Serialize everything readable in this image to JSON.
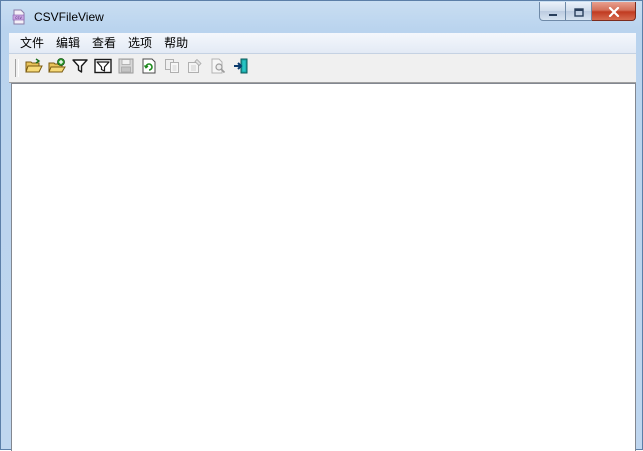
{
  "window": {
    "title": "CSVFileView",
    "app_icon": "csv-app-icon",
    "controls": [
      "minimize-icon",
      "maximize-icon",
      "close-icon"
    ]
  },
  "menu": {
    "items": [
      {
        "label": "文件"
      },
      {
        "label": "编辑"
      },
      {
        "label": "查看"
      },
      {
        "label": "选项"
      },
      {
        "label": "帮助"
      }
    ]
  },
  "toolbar": {
    "buttons": [
      {
        "icon": "open-folder-icon",
        "enabled": true
      },
      {
        "icon": "open-folder-add-icon",
        "enabled": true
      },
      {
        "icon": "filter-icon",
        "enabled": true
      },
      {
        "icon": "advanced-filter-icon",
        "enabled": true
      },
      {
        "icon": "save-icon",
        "enabled": false
      },
      {
        "icon": "refresh-icon",
        "enabled": true
      },
      {
        "icon": "copy-icon",
        "enabled": false
      },
      {
        "icon": "properties-icon",
        "enabled": false
      },
      {
        "icon": "find-icon",
        "enabled": false
      },
      {
        "icon": "exit-icon",
        "enabled": true
      }
    ]
  },
  "colors": {
    "title_bar": "#b9d3ee",
    "close_button": "#c13b21",
    "content_bg": "#ffffff",
    "toolbar_bg": "#f0f0f0"
  }
}
